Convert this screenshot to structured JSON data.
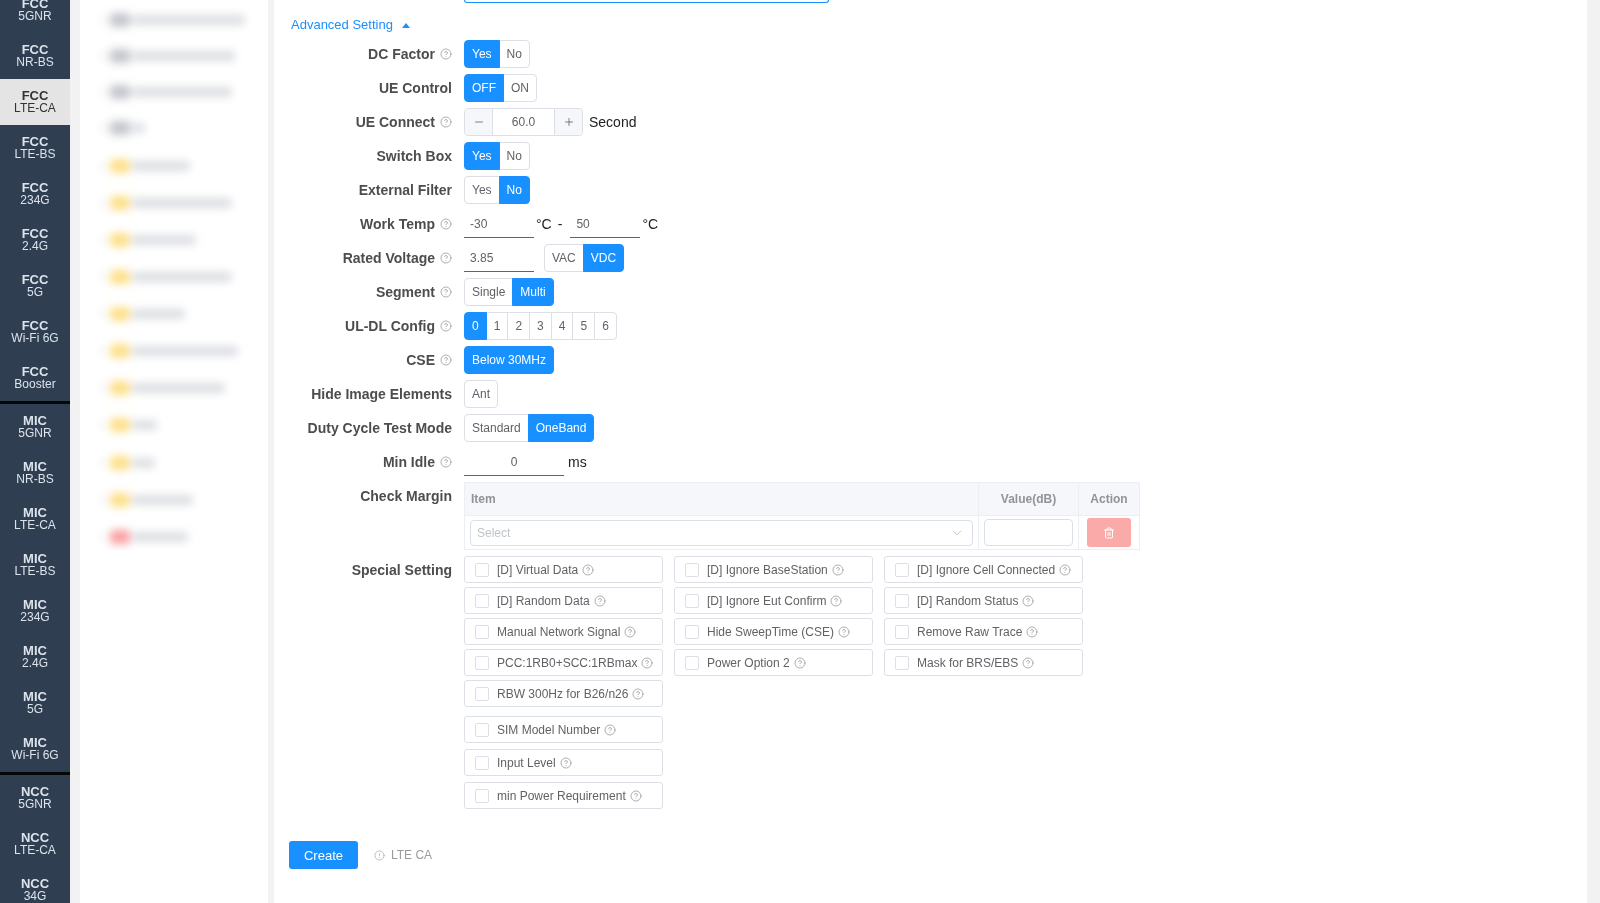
{
  "sidebar": {
    "groups": [
      {
        "items": [
          {
            "title": "FCC",
            "subtitle": "5GNR",
            "selected": false
          },
          {
            "title": "FCC",
            "subtitle": "NR-BS",
            "selected": false
          },
          {
            "title": "FCC",
            "subtitle": "LTE-CA",
            "selected": true
          },
          {
            "title": "FCC",
            "subtitle": "LTE-BS",
            "selected": false
          },
          {
            "title": "FCC",
            "subtitle": "234G",
            "selected": false
          },
          {
            "title": "FCC",
            "subtitle": "2.4G",
            "selected": false
          },
          {
            "title": "FCC",
            "subtitle": "5G",
            "selected": false
          },
          {
            "title": "FCC",
            "subtitle": "Wi-Fi 6G",
            "selected": false
          },
          {
            "title": "FCC",
            "subtitle": "Booster",
            "selected": false
          }
        ]
      },
      {
        "items": [
          {
            "title": "MIC",
            "subtitle": "5GNR",
            "selected": false
          },
          {
            "title": "MIC",
            "subtitle": "NR-BS",
            "selected": false
          },
          {
            "title": "MIC",
            "subtitle": "LTE-CA",
            "selected": false
          },
          {
            "title": "MIC",
            "subtitle": "LTE-BS",
            "selected": false
          },
          {
            "title": "MIC",
            "subtitle": "234G",
            "selected": false
          },
          {
            "title": "MIC",
            "subtitle": "2.4G",
            "selected": false
          },
          {
            "title": "MIC",
            "subtitle": "5G",
            "selected": false
          },
          {
            "title": "MIC",
            "subtitle": "Wi-Fi 6G",
            "selected": false
          }
        ]
      },
      {
        "items": [
          {
            "title": "NCC",
            "subtitle": "5GNR",
            "selected": false
          },
          {
            "title": "NCC",
            "subtitle": "LTE-CA",
            "selected": false
          },
          {
            "title": "NCC",
            "subtitle": "34G",
            "selected": false
          }
        ]
      }
    ]
  },
  "form": {
    "advanced": {
      "label": "Advanced Setting",
      "expanded": true
    },
    "rows": [
      {
        "kind": "radio",
        "label": "DC Factor",
        "help": true,
        "options": [
          {
            "label": "Yes",
            "selected": true
          },
          {
            "label": "No",
            "selected": false
          }
        ]
      },
      {
        "kind": "radio",
        "label": "UE Control",
        "help": false,
        "options": [
          {
            "label": "OFF",
            "selected": true
          },
          {
            "label": "ON",
            "selected": false
          }
        ]
      },
      {
        "kind": "stepper",
        "label": "UE Connect",
        "help": true,
        "value": "60.0",
        "unit": "Second"
      },
      {
        "kind": "radio",
        "label": "Switch Box",
        "help": false,
        "options": [
          {
            "label": "Yes",
            "selected": true
          },
          {
            "label": "No",
            "selected": false
          }
        ]
      },
      {
        "kind": "radio",
        "label": "External Filter",
        "help": false,
        "options": [
          {
            "label": "Yes",
            "selected": false
          },
          {
            "label": "No",
            "selected": true
          }
        ]
      },
      {
        "kind": "range",
        "label": "Work Temp",
        "help": true,
        "min": {
          "value": "-30",
          "unit": "°C"
        },
        "separator": "-",
        "max": {
          "value": "50",
          "unit": "°C"
        }
      },
      {
        "kind": "input_options",
        "label": "Rated Voltage",
        "help": true,
        "value": "3.85",
        "options": [
          {
            "label": "VAC",
            "selected": false
          },
          {
            "label": "VDC",
            "selected": true
          }
        ]
      },
      {
        "kind": "radio",
        "label": "Segment",
        "help": true,
        "options": [
          {
            "label": "Single",
            "selected": false
          },
          {
            "label": "Multi",
            "selected": true
          }
        ]
      },
      {
        "kind": "radio",
        "label": "UL-DL Config",
        "help": true,
        "options": [
          {
            "label": "0",
            "selected": true
          },
          {
            "label": "1",
            "selected": false
          },
          {
            "label": "2",
            "selected": false
          },
          {
            "label": "3",
            "selected": false
          },
          {
            "label": "4",
            "selected": false
          },
          {
            "label": "5",
            "selected": false
          },
          {
            "label": "6",
            "selected": false
          }
        ]
      },
      {
        "kind": "radio",
        "label": "CSE",
        "help": true,
        "options": [
          {
            "label": "Below 30MHz",
            "selected": true
          }
        ]
      },
      {
        "kind": "radio",
        "label": "Hide Image Elements",
        "help": false,
        "options": [
          {
            "label": "Ant",
            "selected": false
          }
        ]
      },
      {
        "kind": "radio",
        "label": "Duty Cycle Test Mode",
        "help": false,
        "options": [
          {
            "label": "Standard",
            "selected": false
          },
          {
            "label": "OneBand",
            "selected": true
          }
        ]
      },
      {
        "kind": "input",
        "label": "Min Idle",
        "help": true,
        "value": "0",
        "unit": "ms"
      },
      {
        "kind": "table",
        "label": "Check Margin",
        "help": false,
        "columns": [
          "Item",
          "Value(dB)",
          "Action"
        ],
        "rows": [
          {
            "item_placeholder": "Select",
            "delete_disabled": true
          }
        ]
      },
      {
        "kind": "checkboxes",
        "label": "Special Setting",
        "help": false,
        "grid": [
          {
            "label": "[D] Virtual Data",
            "checked": false,
            "help": true
          },
          {
            "label": "[D] Ignore BaseStation",
            "checked": false,
            "help": true
          },
          {
            "label": "[D] Ignore Cell Connected",
            "checked": false,
            "help": true
          },
          {
            "label": "[D] Random Data",
            "checked": false,
            "help": true
          },
          {
            "label": "[D] Ignore Eut Confirm",
            "checked": false,
            "help": true
          },
          {
            "label": "[D] Random Status",
            "checked": false,
            "help": true
          },
          {
            "label": "Manual Network Signal",
            "checked": false,
            "help": true
          },
          {
            "label": "Hide SweepTime (CSE)",
            "checked": false,
            "help": true
          },
          {
            "label": "Remove Raw Trace",
            "checked": false,
            "help": true
          },
          {
            "label": "PCC:1RB0+SCC:1RBmax",
            "checked": false,
            "help": true
          },
          {
            "label": "Power Option 2",
            "checked": false,
            "help": true
          },
          {
            "label": "Mask for BRS/EBS",
            "checked": false,
            "help": true
          },
          {
            "label": "RBW 300Hz for B26/n26",
            "checked": false,
            "help": true
          }
        ],
        "extra": [
          {
            "label": "SIM Model Number",
            "checked": false,
            "help": true
          },
          {
            "label": "Input Level",
            "checked": false,
            "help": true
          },
          {
            "label": "min Power Requirement",
            "checked": false,
            "help": true
          }
        ]
      }
    ],
    "submit": {
      "label": "Create"
    },
    "hint": {
      "text": "LTE CA"
    }
  }
}
